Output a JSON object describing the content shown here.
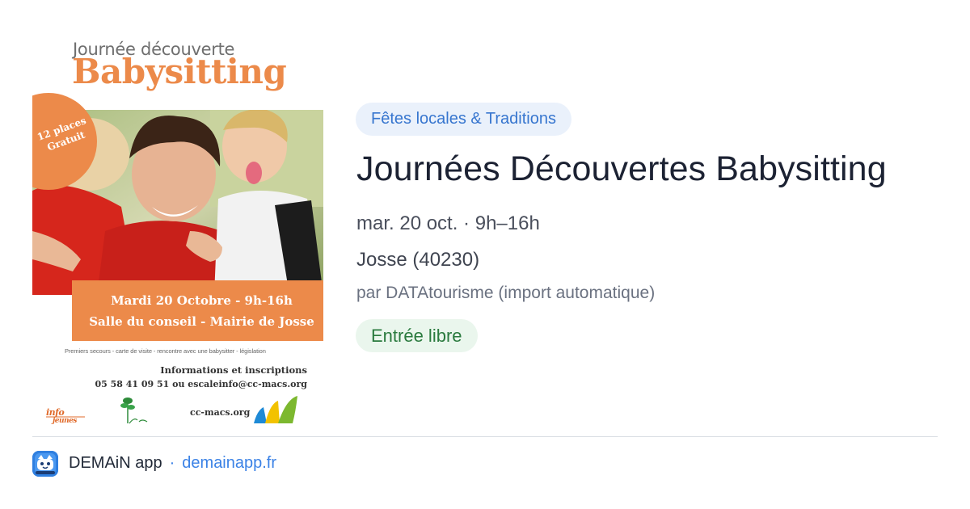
{
  "poster": {
    "kicker": "Journée découverte",
    "title": "Babysitting",
    "badge_line1": "12 places",
    "badge_line2": "Gratuit",
    "banner_line1": "Mardi 20 Octobre - 9h-16h",
    "banner_line2": "Salle du conseil - Mairie de Josse",
    "topics": "Premiers secours - carte de visite - rencontre avec une babysitter - législation",
    "info_heading": "Informations et inscriptions",
    "info_contact": "05 58 41 09 51 ou escaleinfo@cc-macs.org",
    "logo_info_text": "info jeunes",
    "site": "cc-macs.org"
  },
  "event": {
    "category": "Fêtes locales & Traditions",
    "title": "Journées Découvertes Babysitting",
    "date": "mar. 20 oct. · 9h–16h",
    "place": "Josse (40230)",
    "source": "par DATAtourisme (import automatique)",
    "price": "Entrée libre"
  },
  "footer": {
    "app_name": "DEMAiN app",
    "separator": "·",
    "link": "demainapp.fr"
  },
  "colors": {
    "accent_blue": "#3b82e6",
    "category_chip_bg": "#eaf1fb",
    "price_chip_bg": "#eaf6ed",
    "price_chip_text": "#2a7a3e",
    "poster_orange": "#ec8a4a"
  },
  "icons": {
    "app_icon": "demain-app-icon"
  }
}
